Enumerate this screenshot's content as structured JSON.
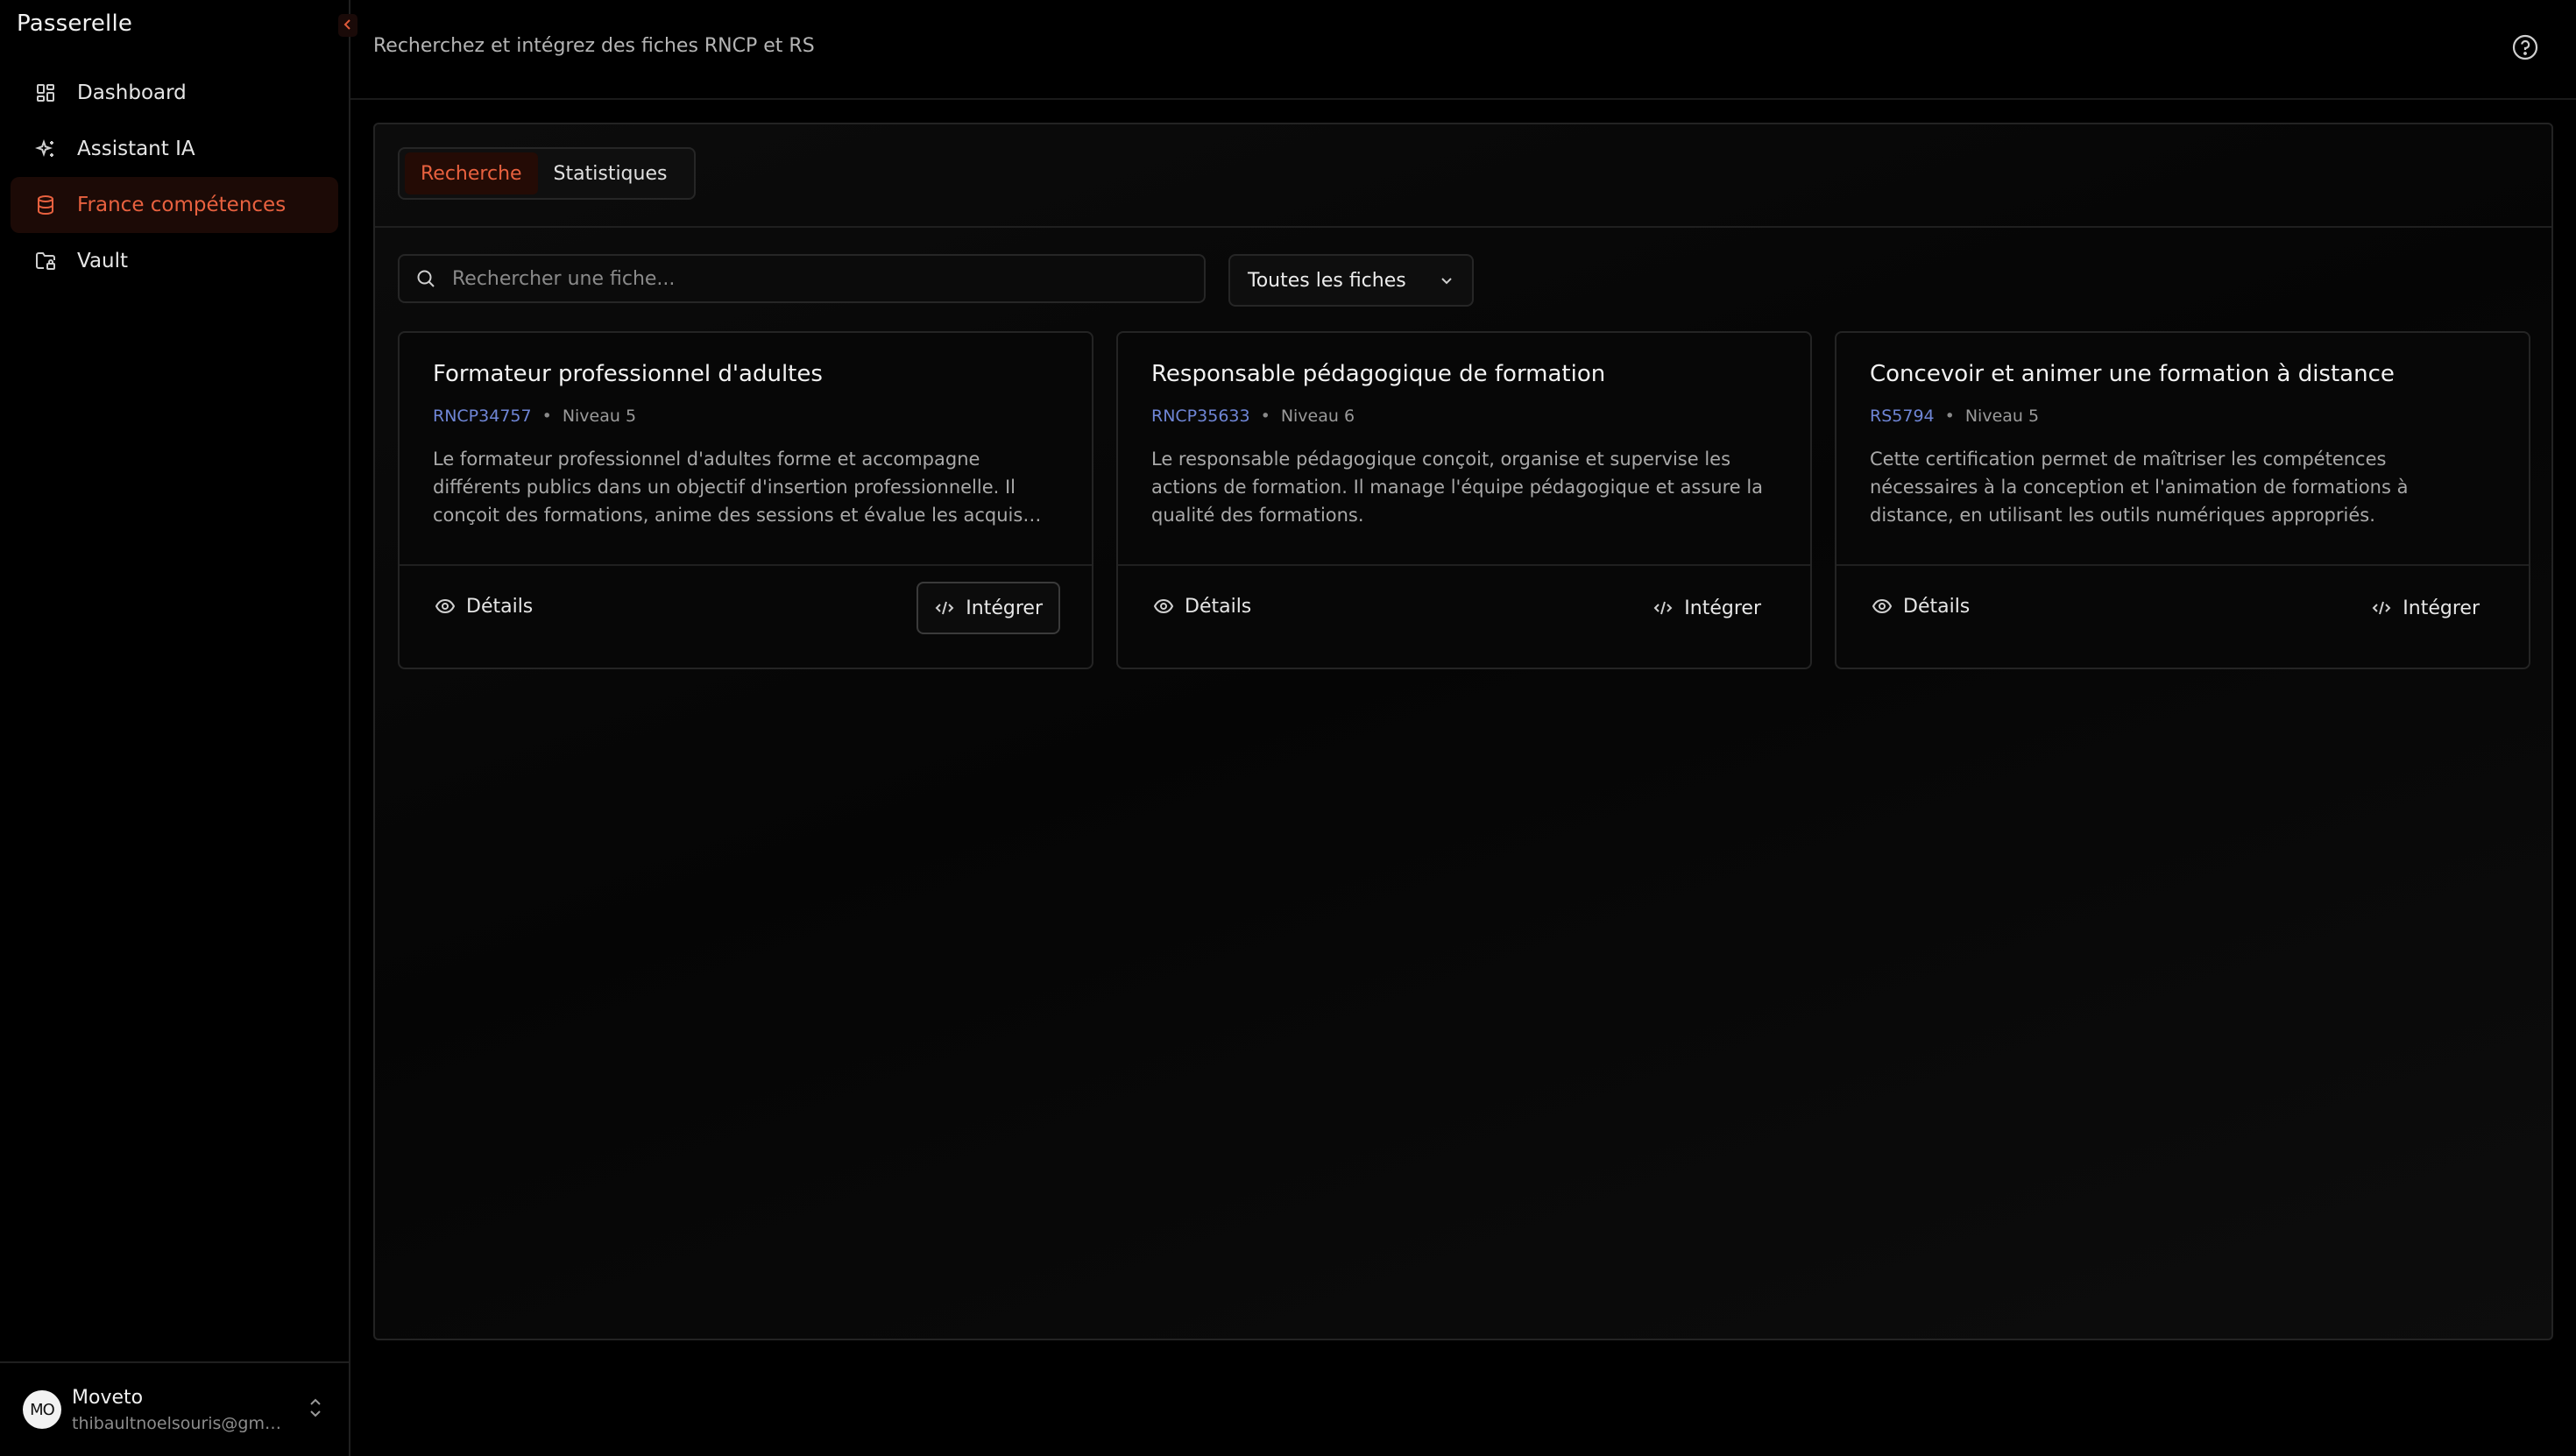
{
  "app": {
    "brand": "Passerelle",
    "collapse_icon": "chevron-left-icon"
  },
  "colors": {
    "accent": "#e8613f",
    "accent_bg": "#1c0a06",
    "code_blue": "#6f86d6",
    "background": "#000000"
  },
  "sidebar": {
    "items": [
      {
        "label": "Dashboard",
        "icon": "dashboard-grid-icon"
      },
      {
        "label": "Assistant IA",
        "icon": "sparkles-icon"
      },
      {
        "label": "France compétences",
        "icon": "database-icon",
        "active": true
      },
      {
        "label": "Vault",
        "icon": "folder-lock-icon"
      }
    ]
  },
  "user": {
    "initials": "MO",
    "name": "Moveto",
    "email": "thibaultnoelsouris@gmail.com"
  },
  "header": {
    "subtitle": "Recherchez et intégrez des fiches RNCP et RS",
    "help_icon": "help-circle-icon"
  },
  "tabs": [
    {
      "label": "Recherche",
      "active": true
    },
    {
      "label": "Statistiques",
      "active": false
    }
  ],
  "search": {
    "placeholder": "Rechercher une fiche...",
    "value": ""
  },
  "filter": {
    "selected": "Toutes les fiches"
  },
  "cards": [
    {
      "title": "Formateur professionnel d'adultes",
      "code": "RNCP34757",
      "level": "Niveau 5",
      "description": "Le formateur professionnel d'adultes forme et accompagne différents publics dans un objectif d'insertion professionnelle. Il conçoit des formations, anime des sessions et évalue les acquis des apprenants.",
      "details_label": "Détails",
      "integrate_label": "Intégrer"
    },
    {
      "title": "Responsable pédagogique de formation",
      "code": "RNCP35633",
      "level": "Niveau 6",
      "description": "Le responsable pédagogique conçoit, organise et supervise les actions de formation. Il manage l'équipe pédagogique et assure la qualité des formations.",
      "details_label": "Détails",
      "integrate_label": "Intégrer"
    },
    {
      "title": "Concevoir et animer une formation à distance",
      "code": "RS5794",
      "level": "Niveau 5",
      "description": "Cette certification permet de maîtriser les compétences nécessaires à la conception et l'animation de formations à distance, en utilisant les outils numériques appropriés.",
      "details_label": "Détails",
      "integrate_label": "Intégrer"
    }
  ]
}
